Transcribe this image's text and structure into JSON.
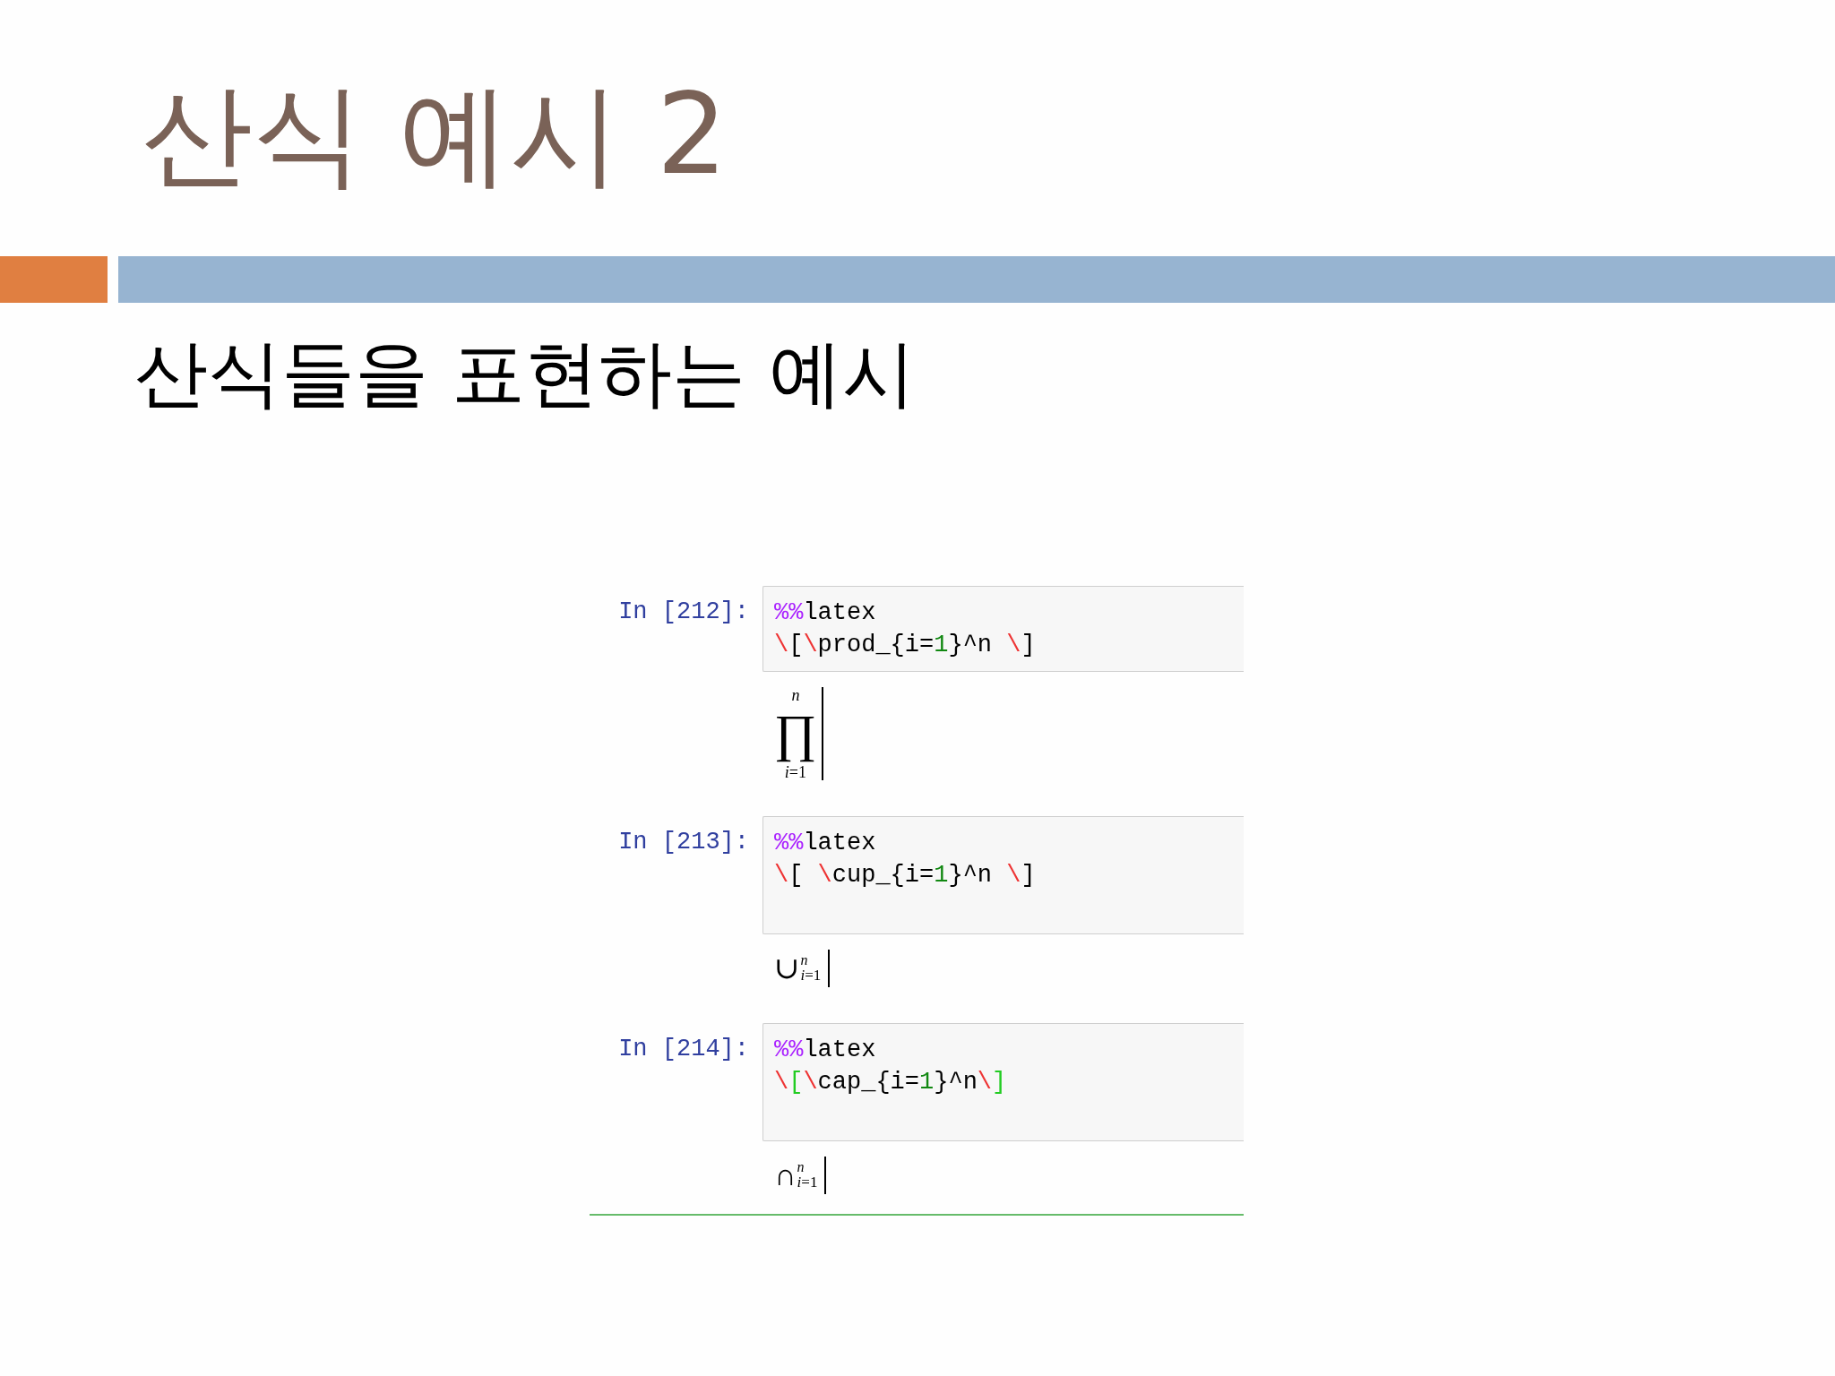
{
  "slide": {
    "title": "산식 예시 2",
    "subtitle": "산식들을 표현하는 예시"
  },
  "notebook": {
    "cells": [
      {
        "prompt": "In [212]:",
        "selected": false,
        "blank_last_line": false,
        "lines": [
          {
            "tokens": [
              {
                "text": "%%",
                "color": "#aa22ff"
              },
              {
                "text": "latex",
                "color": "#000000"
              }
            ]
          },
          {
            "tokens": [
              {
                "text": "\\",
                "color": "#ee3333"
              },
              {
                "text": "[",
                "color": "#000000"
              },
              {
                "text": "\\",
                "color": "#ee3333"
              },
              {
                "text": "prod_{i=",
                "color": "#000000"
              },
              {
                "text": "1",
                "color": "#118811"
              },
              {
                "text": "}^n ",
                "color": "#000000"
              },
              {
                "text": "\\",
                "color": "#ee3333"
              },
              {
                "text": "]",
                "color": "#000000"
              }
            ]
          }
        ],
        "output": {
          "kind": "display",
          "operator": "∏",
          "upper": "n",
          "lower": "*i*=1"
        }
      },
      {
        "prompt": "In [213]:",
        "selected": false,
        "blank_last_line": true,
        "lines": [
          {
            "tokens": [
              {
                "text": "%%",
                "color": "#aa22ff"
              },
              {
                "text": "latex",
                "color": "#000000"
              }
            ]
          },
          {
            "tokens": [
              {
                "text": "\\",
                "color": "#ee3333"
              },
              {
                "text": "[ ",
                "color": "#000000"
              },
              {
                "text": "\\",
                "color": "#ee3333"
              },
              {
                "text": "cup_{i=",
                "color": "#000000"
              },
              {
                "text": "1",
                "color": "#118811"
              },
              {
                "text": "}^n ",
                "color": "#000000"
              },
              {
                "text": "\\",
                "color": "#ee3333"
              },
              {
                "text": "]",
                "color": "#000000"
              }
            ]
          }
        ],
        "output": {
          "kind": "inline",
          "operator": "∪",
          "upper": "n",
          "lower": "*i*=1"
        }
      },
      {
        "prompt": "In [214]:",
        "selected": true,
        "blank_last_line": true,
        "lines": [
          {
            "tokens": [
              {
                "text": "%%",
                "color": "#aa22ff"
              },
              {
                "text": "latex",
                "color": "#000000"
              }
            ]
          },
          {
            "tokens": [
              {
                "text": "\\",
                "color": "#ee3333"
              },
              {
                "text": "[",
                "color": "#22cc22"
              },
              {
                "text": "\\",
                "color": "#ee3333"
              },
              {
                "text": "cap_{i=",
                "color": "#000000"
              },
              {
                "text": "1",
                "color": "#118811"
              },
              {
                "text": "}^n",
                "color": "#000000"
              },
              {
                "text": "\\",
                "color": "#ee3333"
              },
              {
                "text": "]",
                "color": "#22cc22"
              }
            ]
          }
        ],
        "output": {
          "kind": "inline",
          "operator": "∩",
          "upper": "n",
          "lower": "*i*=1"
        }
      }
    ]
  }
}
